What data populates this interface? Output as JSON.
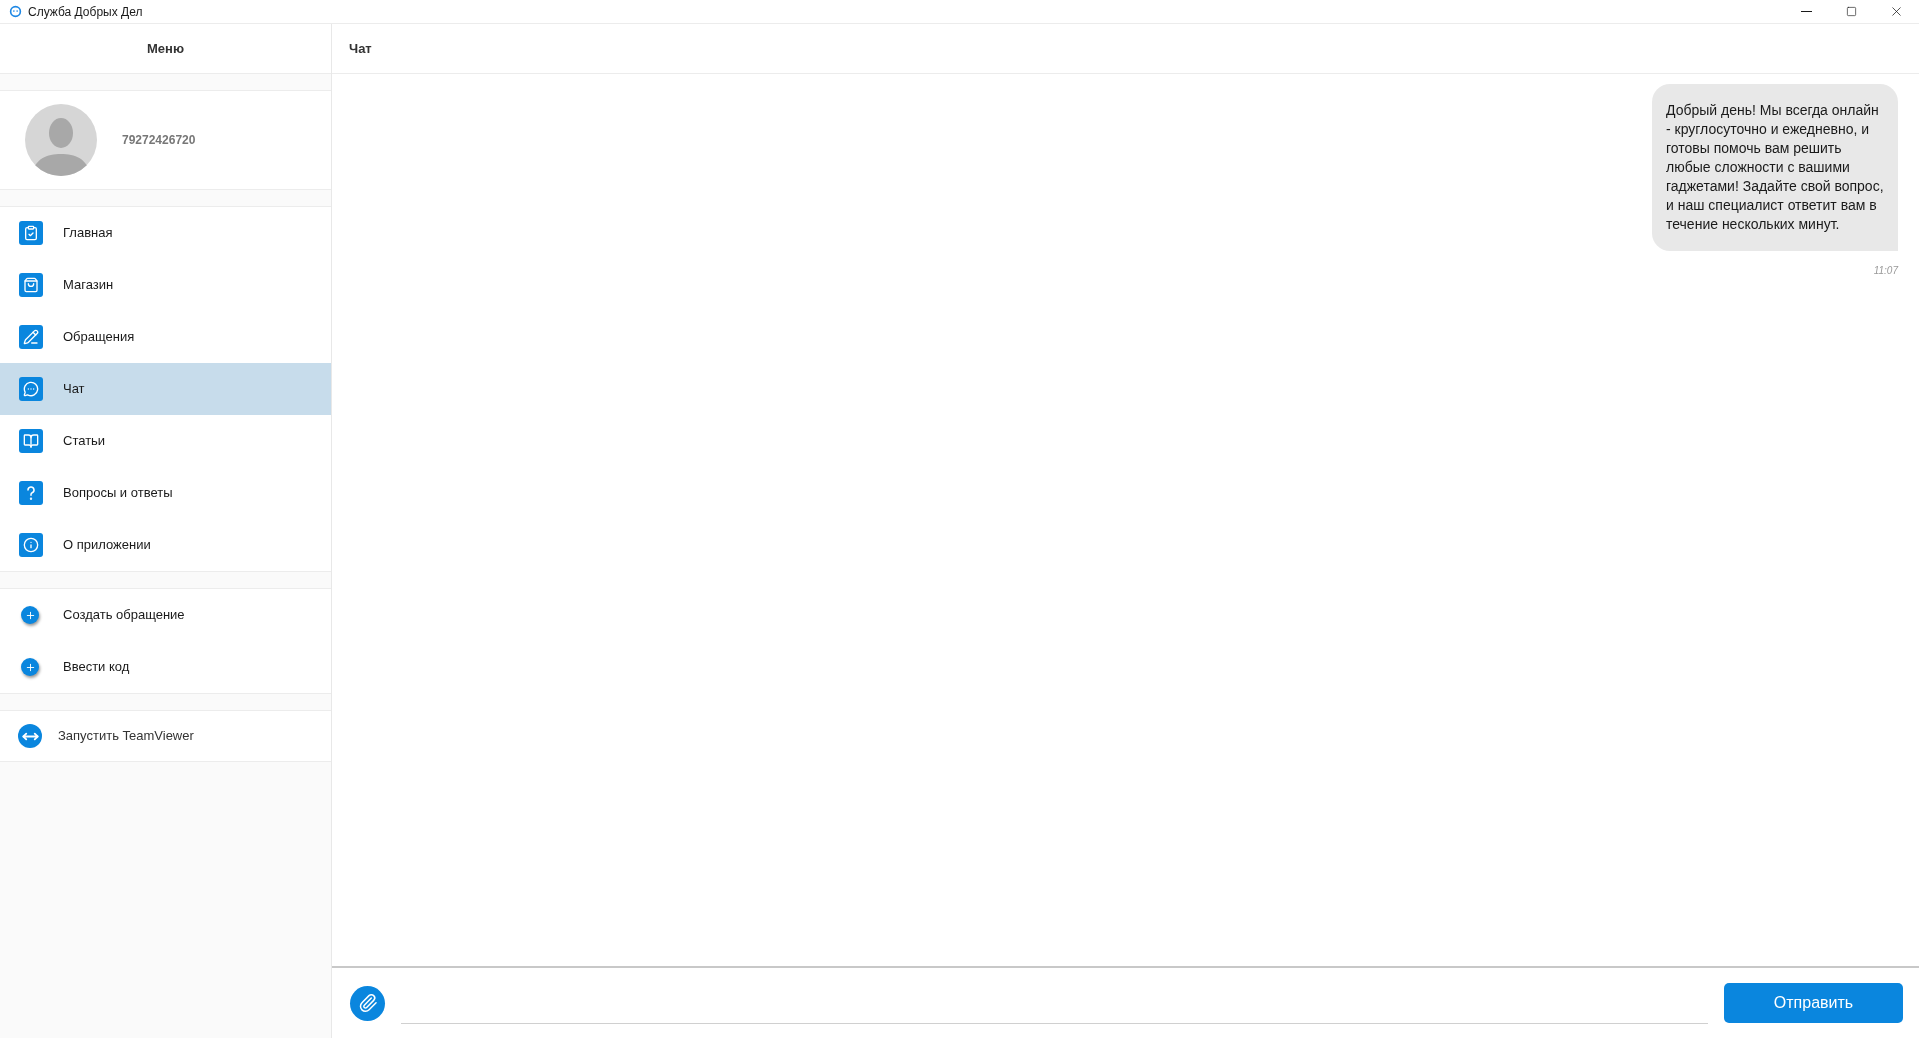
{
  "window": {
    "title": "Служба Добрых Дел"
  },
  "sidebar": {
    "title": "Меню",
    "profile": {
      "phone": "79272426720"
    },
    "nav_items": [
      {
        "label": "Главная",
        "selected": false
      },
      {
        "label": "Магазин",
        "selected": false
      },
      {
        "label": "Обращения",
        "selected": false
      },
      {
        "label": "Чат",
        "selected": true
      },
      {
        "label": "Статьи",
        "selected": false
      },
      {
        "label": "Вопросы и ответы",
        "selected": false
      },
      {
        "label": "О приложении",
        "selected": false
      }
    ],
    "actions": [
      {
        "label": "Создать обращение"
      },
      {
        "label": "Ввести код"
      }
    ],
    "teamviewer": {
      "label": "Запустить TeamViewer"
    }
  },
  "chat": {
    "title": "Чат",
    "messages": [
      {
        "text": "Добрый день! Мы всегда онлайн - круглосуточно и ежедневно, и готовы помочь вам решить любые сложности с вашими гаджетами! Задайте свой вопрос, и наш специалист ответит вам в течение нескольких минут.",
        "time": "11:07"
      }
    ],
    "send_button": "Отправить"
  }
}
